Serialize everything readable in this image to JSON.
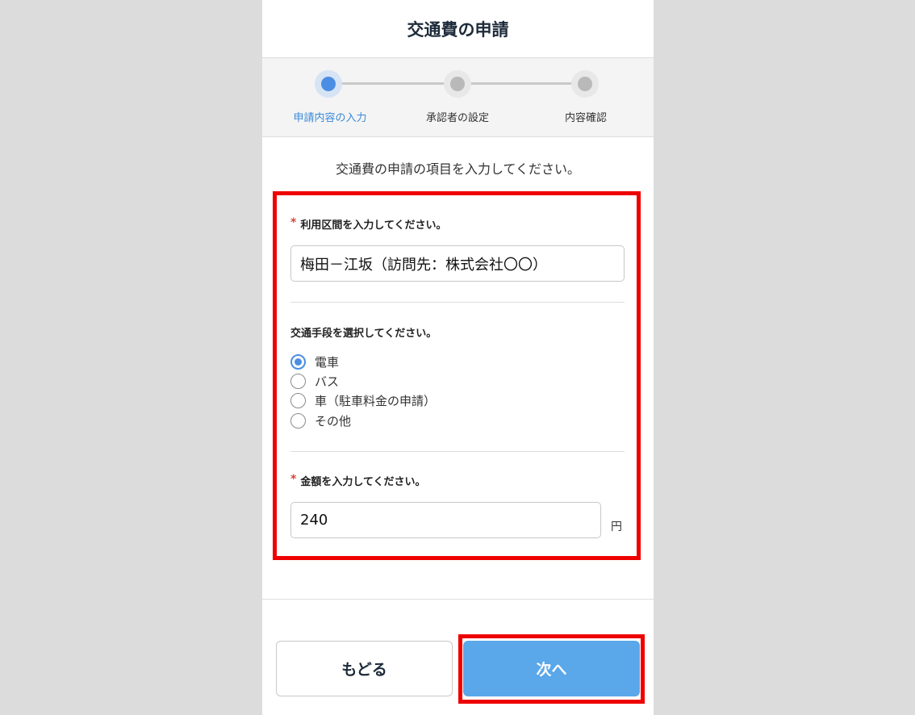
{
  "header": {
    "title": "交通費の申請"
  },
  "stepper": {
    "steps": [
      {
        "label": "申請内容の入力",
        "active": true
      },
      {
        "label": "承認者の設定",
        "active": false
      },
      {
        "label": "内容確認",
        "active": false
      }
    ]
  },
  "form": {
    "intro": "交通費の申請の項目を入力してください。",
    "route": {
      "required_mark": "*",
      "label": "利用区間を入力してください。",
      "value": "梅田－江坂（訪問先：株式会社〇〇）"
    },
    "transport": {
      "label": "交通手段を選択してください。",
      "options": [
        {
          "label": "電車",
          "checked": true
        },
        {
          "label": "バス",
          "checked": false
        },
        {
          "label": "車（駐車料金の申請）",
          "checked": false
        },
        {
          "label": "その他",
          "checked": false
        }
      ]
    },
    "amount": {
      "required_mark": "*",
      "label": "金額を入力してください。",
      "value": "240",
      "unit": "円"
    }
  },
  "footer": {
    "back_label": "もどる",
    "next_label": "次へ"
  },
  "colors": {
    "accent": "#4b8ee3",
    "next_button": "#5aa7ea",
    "highlight": "#ee0000",
    "required": "#d9453a"
  }
}
